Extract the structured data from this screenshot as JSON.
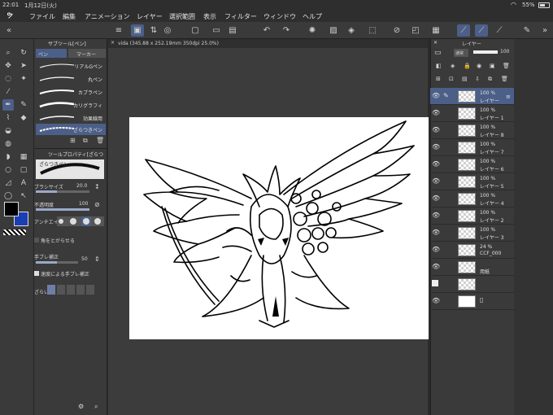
{
  "status": {
    "time": "22:01",
    "date": "1月12日(火)",
    "battery": "55%"
  },
  "menu": [
    "ファイル",
    "編集",
    "アニメーション",
    "レイヤー",
    "選択範囲",
    "表示",
    "フィルター",
    "ウィンドウ",
    "ヘルプ"
  ],
  "subtool": {
    "header": "サブツール[ペン]",
    "tabs": [
      "ペン",
      "マーカー"
    ],
    "brushes": [
      "リアルGペン",
      "丸ペン",
      "カブラペン",
      "カリグラフィ",
      "効果線用",
      "ざらつきペン"
    ],
    "selected_index": 5
  },
  "toolprop": {
    "header": "ツールプロパティ[ざらつ",
    "brush_name": "ざらつきペン",
    "brush_size_label": "ブラシサイズ",
    "brush_size_value": "20.0",
    "opacity_label": "不透明度",
    "opacity_value": "100",
    "antialias_label": "アンチエイ",
    "pointed_label": "角をとがらせる",
    "stabilization_label": "手ブレ補正",
    "stabilization_value": "50",
    "speed_stab_label": "速度による手ブレ補正",
    "texture_label": "ざらい"
  },
  "canvas": {
    "tab_title": "vida (345.88 x 252.19mm 350dpi 25.0%)"
  },
  "layers": {
    "header": "レイヤー",
    "blend_mode": "通常",
    "opacity": "100",
    "rows": [
      {
        "opacity": "100 %",
        "name": "レイヤー",
        "selected": true
      },
      {
        "opacity": "100 %",
        "name": "レイヤー 1"
      },
      {
        "opacity": "100 %",
        "name": "レイヤー 8"
      },
      {
        "opacity": "100 %",
        "name": "レイヤー 7"
      },
      {
        "opacity": "100 %",
        "name": "レイヤー 6"
      },
      {
        "opacity": "100 %",
        "name": "レイヤー 5"
      },
      {
        "opacity": "100 %",
        "name": "レイヤー 4"
      },
      {
        "opacity": "100 %",
        "name": "レイヤー 2"
      },
      {
        "opacity": "100 %",
        "name": "レイヤー 3"
      },
      {
        "opacity": "24 %",
        "name": "CCF_000"
      },
      {
        "opacity": "",
        "name": "用紙"
      }
    ]
  },
  "colors": {
    "accent": "#4b5f88",
    "main_color": "#000000",
    "sub_color": "#1a3fb5",
    "panel": "#3a3a3a"
  }
}
